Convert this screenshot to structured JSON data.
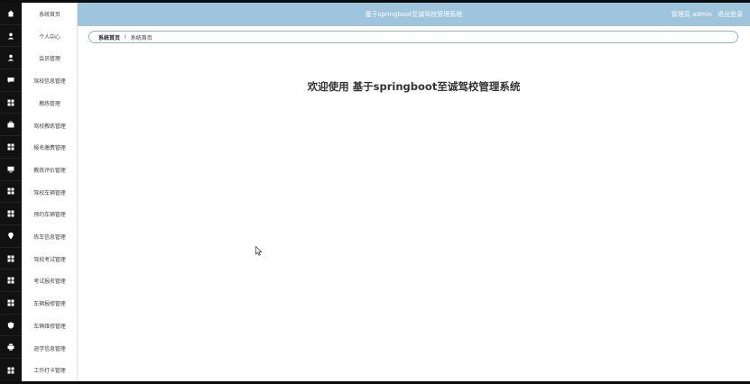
{
  "header": {
    "title": "基于springboot至诚驾校管理系统",
    "user": "管理员 admin",
    "logout": "退出登录",
    "bg_color": "#9ec4de"
  },
  "breadcrumb": {
    "home": "系统首页",
    "separator": "Ⅰ",
    "current": "系统首页"
  },
  "welcome": "欢迎使用 基于springboot至诚驾校管理系统",
  "sidebar": {
    "items": [
      {
        "label": "系统首页",
        "icon": "home-icon"
      },
      {
        "label": "个人中心",
        "icon": "user-icon"
      },
      {
        "label": "会员管理",
        "icon": "user-icon"
      },
      {
        "label": "驾校信息管理",
        "icon": "chat-icon"
      },
      {
        "label": "教练管理",
        "icon": "grid-icon"
      },
      {
        "label": "驾校教练管理",
        "icon": "briefcase-icon"
      },
      {
        "label": "报名缴费管理",
        "icon": "grid-icon"
      },
      {
        "label": "教练评价管理",
        "icon": "monitor-icon"
      },
      {
        "label": "驾校车辆管理",
        "icon": "grid-icon"
      },
      {
        "label": "预约车辆管理",
        "icon": "grid-icon"
      },
      {
        "label": "练车信息管理",
        "icon": "pin-icon"
      },
      {
        "label": "驾校考试管理",
        "icon": "grid-icon"
      },
      {
        "label": "考试报名管理",
        "icon": "grid-icon"
      },
      {
        "label": "车辆报修管理",
        "icon": "grid-icon"
      },
      {
        "label": "车辆维修管理",
        "icon": "shield-icon"
      },
      {
        "label": "退学信息管理",
        "icon": "print-icon"
      },
      {
        "label": "工作打卡管理",
        "icon": "grid-icon"
      }
    ]
  }
}
